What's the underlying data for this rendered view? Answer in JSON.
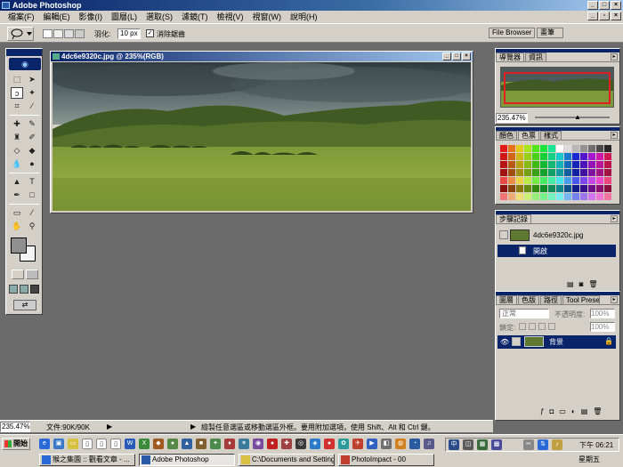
{
  "window": {
    "title": "Adobe Photoshop"
  },
  "menu": {
    "items": [
      "檔案(F)",
      "編輯(E)",
      "影像(I)",
      "圖層(L)",
      "選取(S)",
      "濾鏡(T)",
      "檢視(V)",
      "視窗(W)",
      "說明(H)"
    ]
  },
  "options": {
    "feather_label": "羽化:",
    "feather_value": "10 px",
    "antialias_label": "消除鋸齒",
    "antialias_checked": true,
    "file_browser_label": "File Browser",
    "brushes_label": "畫筆"
  },
  "document": {
    "title": "4dc6e9320c.jpg @ 235%(RGB)",
    "corner_label": "01"
  },
  "navigator": {
    "tabs": [
      "導覽器",
      "資訊"
    ],
    "zoom": "235.47%"
  },
  "swatches": {
    "tabs": [
      "顏色",
      "色票",
      "樣式"
    ]
  },
  "history": {
    "tabs": [
      "步驟記錄"
    ],
    "snapshot_name": "4dc6e9320c.jpg",
    "states": [
      "開啟"
    ]
  },
  "layers": {
    "tabs": [
      "圖層",
      "色版",
      "路徑",
      "Tool Presets"
    ],
    "blend_mode": "正常",
    "opacity_label": "不透明度:",
    "opacity_value": "100%",
    "lock_label": "鎖定:",
    "fill_value": "100%",
    "layer_name": "背景"
  },
  "status": {
    "zoom": "235.47%",
    "doc_size": "文件:90K/90K",
    "hint": "繪製任意選區或移動選區外框。要用附加選項，使用 Shift、Alt 和 Ctrl 鍵。"
  },
  "taskbar": {
    "start_label": "開始",
    "tasks": [
      "猴之集園 :: 觀看文章 - ...",
      "Adobe Photoshop",
      "C:\\Documents and Setting...",
      "PhotoImpact - 00"
    ],
    "clock_time": "下午 06:21",
    "clock_day": "星期五"
  },
  "colors": {
    "titlebar": "#0a246a",
    "chrome": "#d4d0c8",
    "workspace": "#6b6b6b",
    "selection": "#0a246a"
  }
}
